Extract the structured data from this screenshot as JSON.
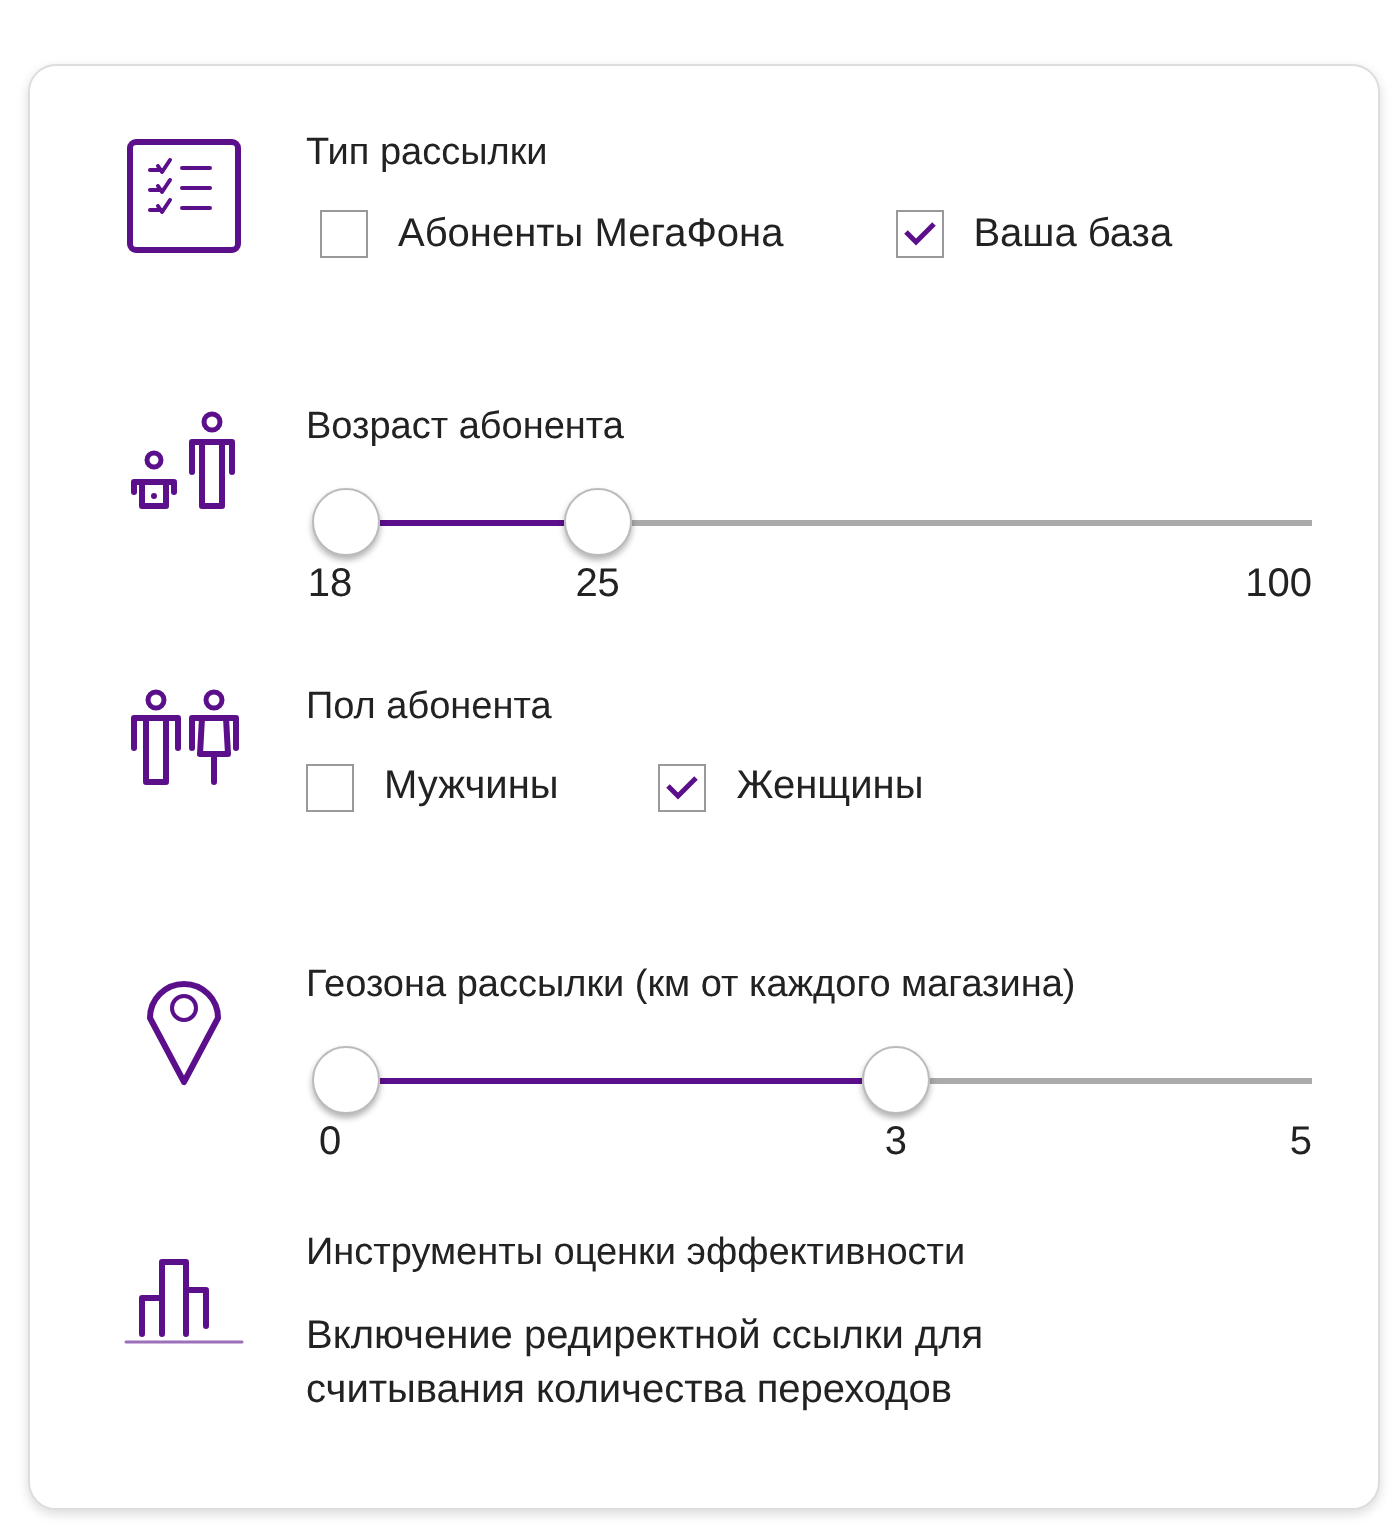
{
  "sections": [
    {
      "kind": "checkboxes",
      "title": "Тип рассылки",
      "options": [
        {
          "label": "Абоненты МегаФона",
          "checked": false
        },
        {
          "label": "Ваша база",
          "checked": true
        }
      ]
    },
    {
      "kind": "range",
      "title": "Возраст абонента",
      "thumbs": [
        {
          "level": 0,
          "label": "18"
        },
        {
          "level": 0.27,
          "label": "25"
        }
      ],
      "max_label": "100"
    },
    {
      "kind": "checkboxes",
      "title": "Пол абонента",
      "options": [
        {
          "label": "Мужчины",
          "checked": false
        },
        {
          "label": "Женщины",
          "checked": true
        }
      ]
    },
    {
      "kind": "range",
      "title": "Геозона рассылки (км от каждого магазина)",
      "thumbs": [
        {
          "level": 0,
          "label": "0"
        },
        {
          "level": 0.59,
          "label": "3"
        }
      ],
      "max_label": "5"
    },
    {
      "kind": "info",
      "title": "Инструменты оценки эффективности",
      "text": "Включение редиректной ссылки для считывания количества переходов"
    }
  ]
}
